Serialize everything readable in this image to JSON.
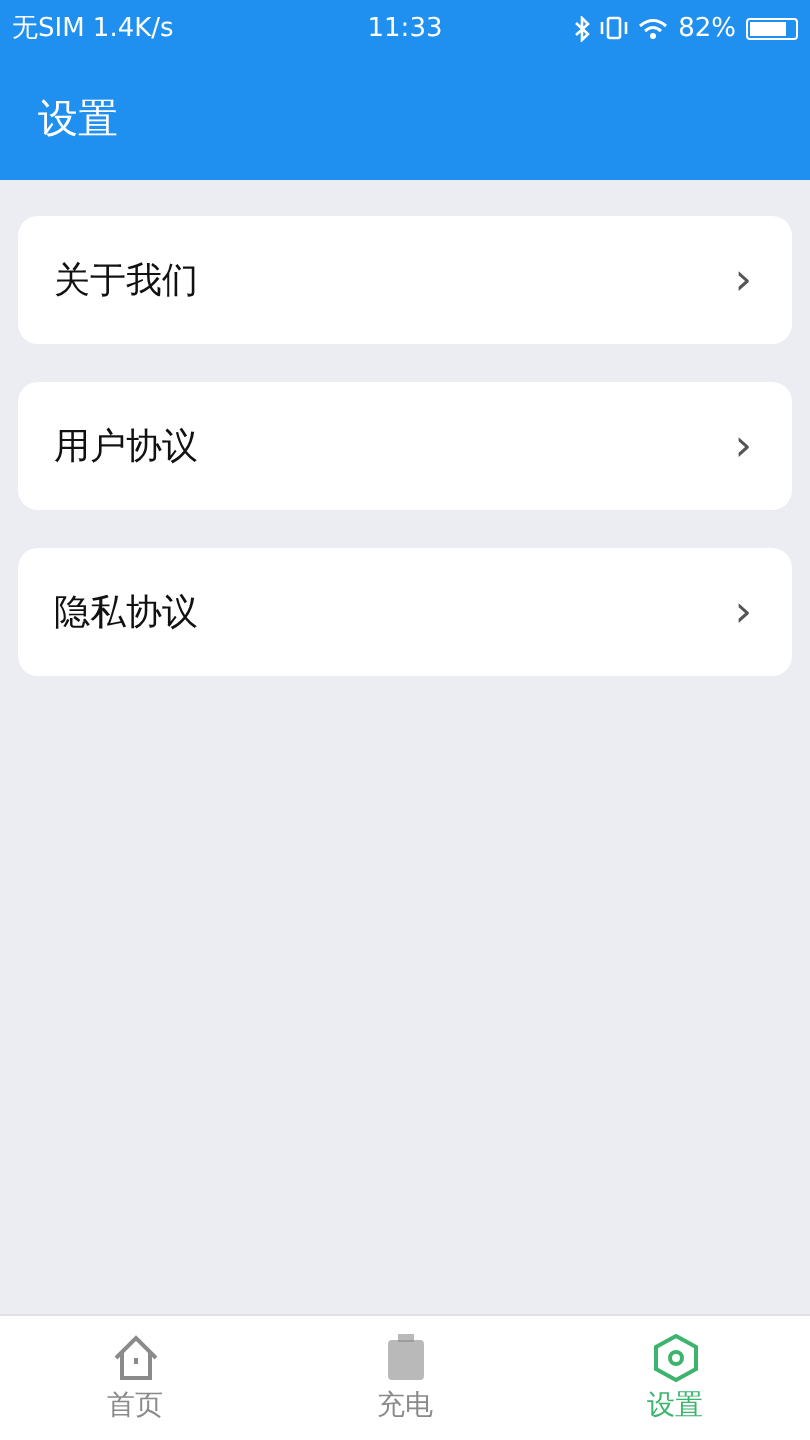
{
  "status_bar": {
    "carrier": "无SIM 1.4K/s",
    "time": "11:33",
    "battery": "82%"
  },
  "header": {
    "title": "设置"
  },
  "menu_items": [
    {
      "label": "关于我们",
      "chevron": "›"
    },
    {
      "label": "用户协议",
      "chevron": "›"
    },
    {
      "label": "隐私协议",
      "chevron": "›"
    }
  ],
  "tabs": [
    {
      "label": "首页",
      "kind": "home",
      "selected": false
    },
    {
      "label": "充电",
      "kind": "charge",
      "selected": false
    },
    {
      "label": "设置",
      "kind": "settings",
      "selected": true
    }
  ]
}
